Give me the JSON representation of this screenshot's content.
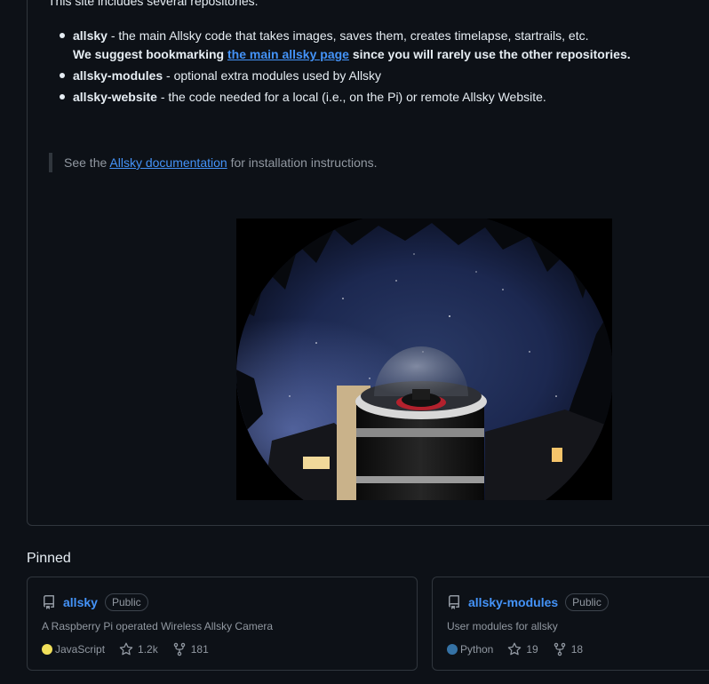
{
  "readme": {
    "intro": "This site includes several repositories:",
    "items": [
      {
        "name": "allsky",
        "text": " - the main Allsky code that takes images, saves them, creates timelapse, startrails, etc."
      },
      {
        "name": "allsky-modules",
        "text": " - optional extra modules used by Allsky"
      },
      {
        "name": "allsky-website",
        "text": " - the code needed for a local (i.e., on the Pi) or remote Allsky Website."
      }
    ],
    "suggest_prefix": "We suggest bookmarking ",
    "suggest_link": "the main allsky page",
    "suggest_suffix": " since you will rarely use the other repositories.",
    "quote_prefix": "See the ",
    "quote_link": "Allsky documentation",
    "quote_suffix": " for installation instructions."
  },
  "pinned": {
    "title": "Pinned",
    "cards": [
      {
        "name": "allsky",
        "visibility": "Public",
        "description": "A Raspberry Pi operated Wireless Allsky Camera",
        "language": "JavaScript",
        "language_color": "#f1e05a",
        "stars": "1.2k",
        "forks": "181"
      },
      {
        "name": "allsky-modules",
        "visibility": "Public",
        "description": "User modules for allsky",
        "language": "Python",
        "language_color": "#3572A5",
        "stars": "19",
        "forks": "18"
      }
    ]
  },
  "colors": {
    "accent": "#4493f8",
    "background": "#0d1117",
    "border": "#30363d",
    "muted": "#9198a1"
  },
  "icons": [
    "repo-icon",
    "star-icon",
    "fork-icon"
  ]
}
